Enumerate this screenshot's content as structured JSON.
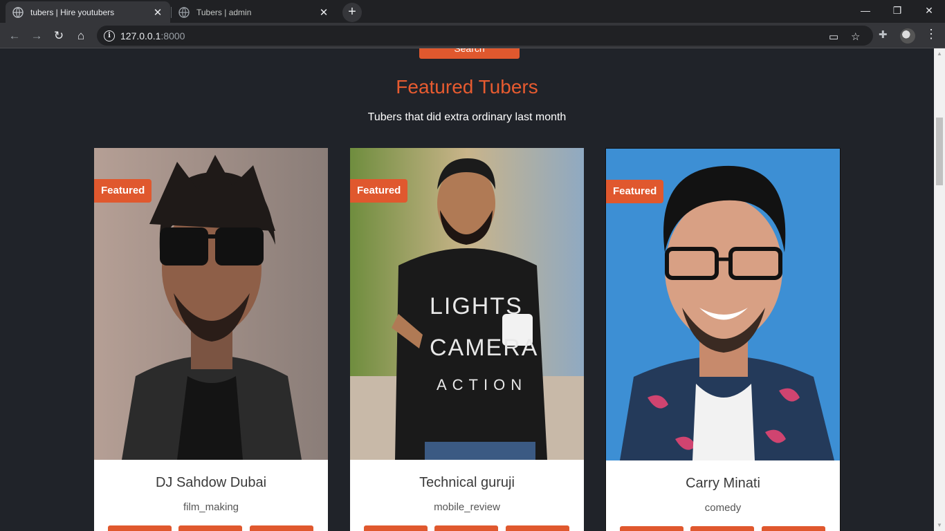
{
  "browser": {
    "tabs": [
      {
        "title": "tubers | Hire youtubers",
        "active": true
      },
      {
        "title": "Tubers | admin",
        "active": false
      }
    ],
    "url_host": "127.0.0.1",
    "url_port": ":8000",
    "icons": {
      "back": "back-arrow-icon",
      "forward": "forward-arrow-icon",
      "reload": "reload-icon",
      "home": "home-icon",
      "site_info": "info-icon",
      "cast": "cast-icon",
      "bookmark": "star-icon",
      "extensions": "puzzle-icon",
      "menu": "kebab-menu-icon"
    }
  },
  "page": {
    "search_label": "Search",
    "section_title": "Featured Tubers",
    "section_subtitle": "Tubers that did extra ordinary last month",
    "accent_color": "#e0582e",
    "background_color": "#202329",
    "cards": [
      {
        "badge": "Featured",
        "name": "DJ Sahdow Dubai",
        "category": "film_making"
      },
      {
        "badge": "Featured",
        "name": "Technical guruji",
        "category": "mobile_review"
      },
      {
        "badge": "Featured",
        "name": "Carry Minati",
        "category": "comedy"
      }
    ]
  }
}
